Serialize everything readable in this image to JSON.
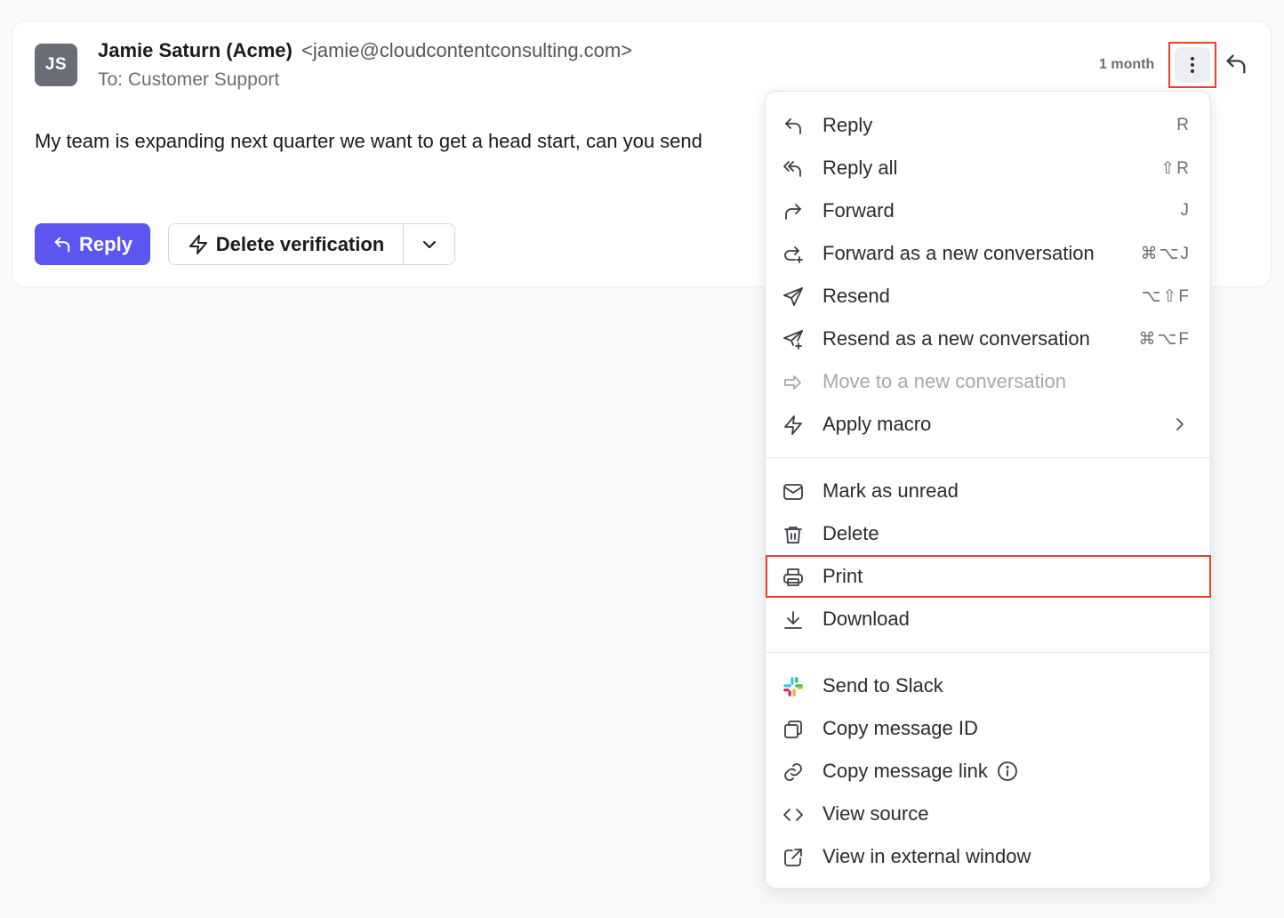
{
  "email": {
    "avatar_initials": "JS",
    "sender_name": "Jamie Saturn (Acme)",
    "sender_email": "<jamie@cloudcontentconsulting.com>",
    "recipient": "To: Customer Support",
    "time": "1 month",
    "body": "My team is expanding next quarter we want to get a head start, can you send"
  },
  "actions": {
    "reply_label": "Reply",
    "macro_label": "Delete verification"
  },
  "menu": {
    "items": [
      {
        "label": "Reply",
        "shortcut": "R",
        "icon": "reply-icon"
      },
      {
        "label": "Reply all",
        "shortcut": "⇧R",
        "icon": "reply-all-icon"
      },
      {
        "label": "Forward",
        "shortcut": "J",
        "icon": "forward-icon"
      },
      {
        "label": "Forward as a new conversation",
        "shortcut": "⌘⌥J",
        "icon": "forward-new-icon"
      },
      {
        "label": "Resend",
        "shortcut": "⌥⇧F",
        "icon": "send-icon"
      },
      {
        "label": "Resend as a new conversation",
        "shortcut": "⌘⌥F",
        "icon": "send-new-icon"
      },
      {
        "label": "Move to a new conversation",
        "shortcut": "",
        "icon": "move-arrow-icon",
        "disabled": true
      },
      {
        "label": "Apply macro",
        "shortcut": "",
        "icon": "lightning-icon"
      },
      {
        "label": "Mark as unread",
        "icon": "envelope-icon"
      },
      {
        "label": "Delete",
        "icon": "trash-icon"
      },
      {
        "label": "Print",
        "icon": "printer-icon"
      },
      {
        "label": "Download",
        "icon": "download-icon"
      },
      {
        "label": "Send to Slack",
        "icon": "slack-icon"
      },
      {
        "label": "Copy message ID",
        "icon": "copy-icon"
      },
      {
        "label": "Copy message link",
        "icon": "link-icon"
      },
      {
        "label": "View source",
        "icon": "code-icon"
      },
      {
        "label": "View in external window",
        "icon": "external-link-icon"
      }
    ]
  },
  "colors": {
    "accent": "#5b56f0",
    "highlight_outline": "#e0452d",
    "avatar_bg": "#6a6d75"
  }
}
